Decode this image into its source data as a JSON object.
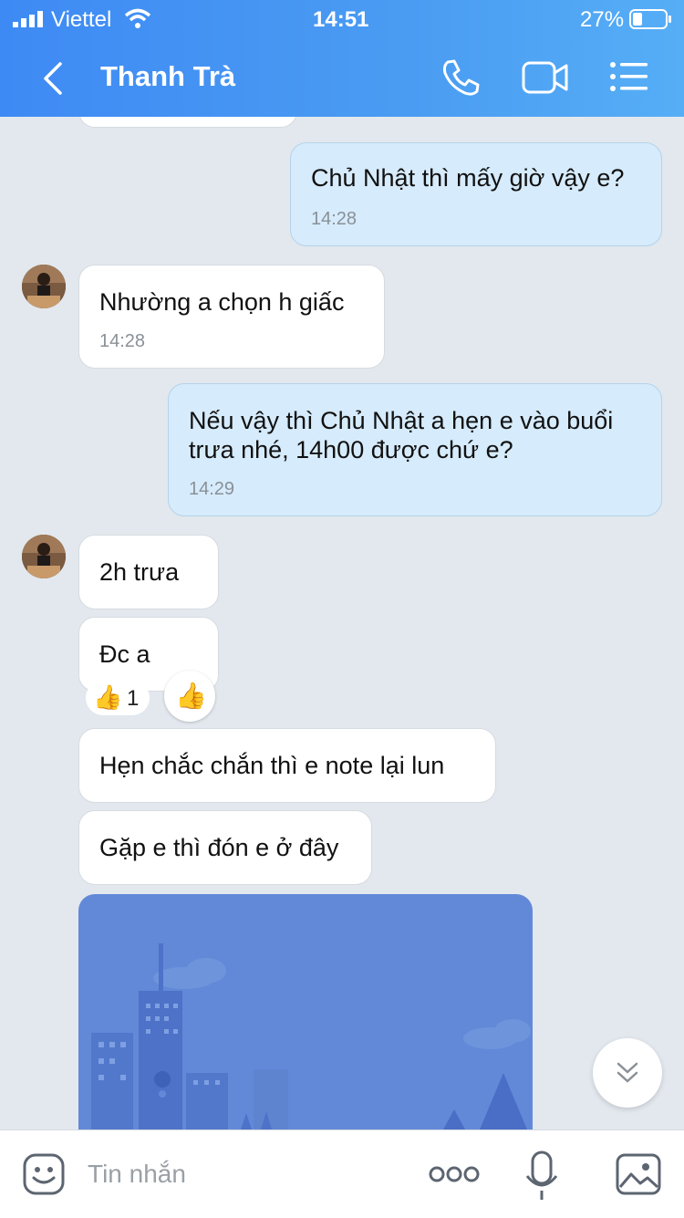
{
  "status_bar": {
    "carrier": "Viettel",
    "time": "14:51",
    "battery": "27%"
  },
  "header": {
    "title": "Thanh Trà"
  },
  "messages": [
    {
      "text": "Chủ Nhật thì mấy giờ vậy e?",
      "time": "14:28",
      "side": "out"
    },
    {
      "text": "Nhường a chọn h giấc",
      "time": "14:28",
      "side": "in"
    },
    {
      "text": "Nếu vậy thì Chủ Nhật a hẹn e vào buổi\ntrưa nhé, 14h00 được chứ e?",
      "time": "14:29",
      "side": "out"
    },
    {
      "text": "2h trưa",
      "side": "in"
    },
    {
      "text": "Đc a",
      "side": "in",
      "reaction": {
        "emoji": "👍",
        "count": "1"
      }
    },
    {
      "text": "Hẹn chắc chắn thì e note lại lun",
      "side": "in"
    },
    {
      "text": "Gặp e thì đón e ở đây",
      "side": "in"
    }
  ],
  "reaction_button": {
    "emoji": "👍"
  },
  "input": {
    "placeholder": "Tin nhắn"
  },
  "colors": {
    "header_start": "#3e8af4",
    "header_end": "#56aef6",
    "out_bubble": "#d6ebfb",
    "map_blue": "#6289d8"
  },
  "icons": [
    "back-icon",
    "phone-icon",
    "video-icon",
    "menu-icon",
    "scroll-down-icon",
    "sticker-icon",
    "more-icon",
    "microphone-icon",
    "image-icon"
  ]
}
